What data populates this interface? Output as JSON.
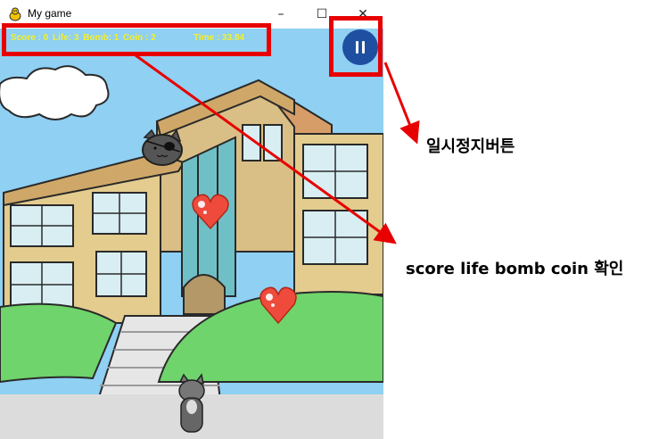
{
  "window": {
    "title": "My game",
    "minimize_glyph": "–",
    "maximize_glyph": "☐",
    "close_glyph": "✕"
  },
  "hud": {
    "score": "Score : 0",
    "life": "Life: 3",
    "bomb": "Bomb: 1",
    "coin": "Coin : 2",
    "time": "Time : 33.84"
  },
  "annotations": {
    "pause_note": "일시정지버튼",
    "stats_note": "score life bomb coin 확인"
  },
  "icons": [
    "pygame-icon",
    "pause-icon",
    "heart-icon",
    "cat-icon"
  ],
  "colors": {
    "hud_text": "#f5ef2a",
    "highlight": "#e80000",
    "pause_button": "#1e4fa0",
    "sky": "#8fd0f3",
    "grass": "#6fd46b"
  }
}
